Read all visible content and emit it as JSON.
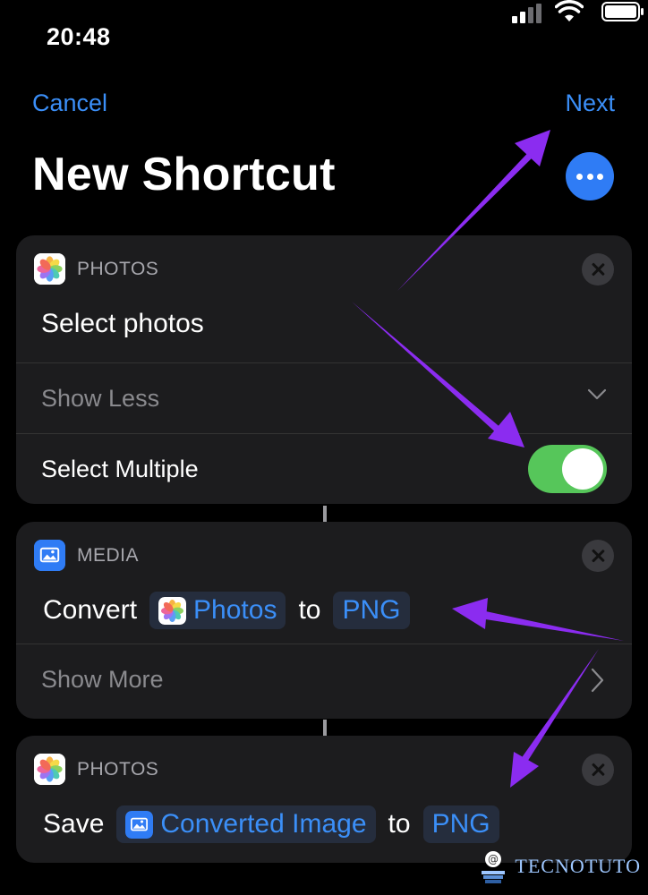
{
  "status_bar": {
    "time": "20:48"
  },
  "nav": {
    "cancel_label": "Cancel",
    "next_label": "Next"
  },
  "title": "New Shortcut",
  "cards": [
    {
      "app": "PHOTOS",
      "action": "Select photos",
      "show_less": "Show Less",
      "option_label": "Select Multiple",
      "option_on": true
    },
    {
      "app": "MEDIA",
      "action_verb": "Convert",
      "input_token": "Photos",
      "connector": "to",
      "format_token": "PNG",
      "show_more": "Show More"
    },
    {
      "app": "PHOTOS",
      "action_verb": "Save",
      "input_token": "Converted Image",
      "connector": "to",
      "format_token": "PNG"
    }
  ],
  "watermark": "TECNOTUTO",
  "colors": {
    "accent": "#3b8ff8",
    "toggle_on": "#56c65a",
    "arrow": "#8b2cf0",
    "card": "#1c1c1e"
  }
}
